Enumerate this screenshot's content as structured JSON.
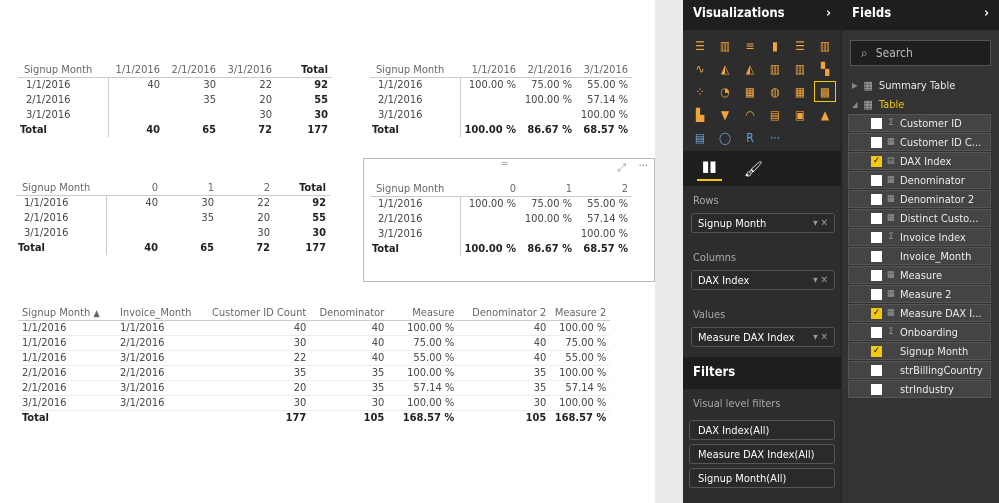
{
  "matrix1": {
    "headers": [
      "Signup Month",
      "1/1/2016",
      "2/1/2016",
      "3/1/2016",
      "Total"
    ],
    "rows": [
      [
        "1/1/2016",
        "40",
        "30",
        "22",
        "92"
      ],
      [
        "2/1/2016",
        "",
        "35",
        "20",
        "55"
      ],
      [
        "3/1/2016",
        "",
        "",
        "30",
        "30"
      ]
    ],
    "total": [
      "Total",
      "40",
      "65",
      "72",
      "177"
    ]
  },
  "matrix2": {
    "headers": [
      "Signup Month",
      "1/1/2016",
      "2/1/2016",
      "3/1/2016"
    ],
    "rows": [
      [
        "1/1/2016",
        "100.00 %",
        "75.00 %",
        "55.00 %"
      ],
      [
        "2/1/2016",
        "",
        "100.00 %",
        "57.14 %"
      ],
      [
        "3/1/2016",
        "",
        "",
        "100.00 %"
      ]
    ],
    "total": [
      "Total",
      "100.00 %",
      "86.67 %",
      "68.57 %"
    ]
  },
  "matrix3": {
    "headers": [
      "Signup Month",
      "0",
      "1",
      "2",
      "Total"
    ],
    "rows": [
      [
        "1/1/2016",
        "40",
        "30",
        "22",
        "92"
      ],
      [
        "2/1/2016",
        "",
        "35",
        "20",
        "55"
      ],
      [
        "3/1/2016",
        "",
        "",
        "30",
        "30"
      ]
    ],
    "total": [
      "Total",
      "40",
      "65",
      "72",
      "177"
    ]
  },
  "matrix4": {
    "headers": [
      "Signup Month",
      "0",
      "1",
      "2"
    ],
    "rows": [
      [
        "1/1/2016",
        "100.00 %",
        "75.00 %",
        "55.00 %"
      ],
      [
        "2/1/2016",
        "",
        "100.00 %",
        "57.14 %"
      ],
      [
        "3/1/2016",
        "",
        "",
        "100.00 %"
      ]
    ],
    "total": [
      "Total",
      "100.00 %",
      "86.67 %",
      "68.57 %"
    ]
  },
  "table5": {
    "headers": [
      "Signup Month",
      "Invoice_Month",
      "Customer ID Count",
      "Denominator",
      "Measure",
      "Denominator 2",
      "Measure 2"
    ],
    "sort_indicator": "▲",
    "rows": [
      [
        "1/1/2016",
        "1/1/2016",
        "40",
        "40",
        "100.00 %",
        "40",
        "100.00 %"
      ],
      [
        "1/1/2016",
        "2/1/2016",
        "30",
        "40",
        "75.00 %",
        "40",
        "75.00 %"
      ],
      [
        "1/1/2016",
        "3/1/2016",
        "22",
        "40",
        "55.00 %",
        "40",
        "55.00 %"
      ],
      [
        "2/1/2016",
        "2/1/2016",
        "35",
        "35",
        "100.00 %",
        "35",
        "100.00 %"
      ],
      [
        "2/1/2016",
        "3/1/2016",
        "20",
        "35",
        "57.14 %",
        "35",
        "57.14 %"
      ],
      [
        "3/1/2016",
        "3/1/2016",
        "30",
        "30",
        "100.00 %",
        "30",
        "100.00 %"
      ]
    ],
    "total": [
      "Total",
      "",
      "177",
      "105",
      "168.57 %",
      "105",
      "168.57 %"
    ]
  },
  "visual_header": {
    "more": "···"
  },
  "visualizations": {
    "title": "Visualizations",
    "more_icons": "···",
    "rows_label": "Rows",
    "rows_value": "Signup Month",
    "columns_label": "Columns",
    "columns_value": "DAX Index",
    "values_label": "Values",
    "values_value": "Measure DAX Index",
    "filters_title": "Filters",
    "visual_level_filters": "Visual level filters",
    "filters": [
      "DAX Index(All)",
      "Measure DAX Index(All)",
      "Signup Month(All)"
    ]
  },
  "fields": {
    "title": "Fields",
    "search_placeholder": "Search",
    "tables": [
      "Summary Table",
      "Table"
    ],
    "items": [
      {
        "label": "Customer ID",
        "type": "Σ",
        "checked": false
      },
      {
        "label": "Customer ID C...",
        "type": "▦",
        "checked": false
      },
      {
        "label": "DAX Index",
        "type": "▤",
        "checked": true
      },
      {
        "label": "Denominator",
        "type": "▦",
        "checked": false
      },
      {
        "label": "Denominator 2",
        "type": "▦",
        "checked": false
      },
      {
        "label": "Distinct Custo...",
        "type": "▦",
        "checked": false
      },
      {
        "label": "Invoice Index",
        "type": "Σ",
        "checked": false
      },
      {
        "label": "Invoice_Month",
        "type": "",
        "checked": false
      },
      {
        "label": "Measure",
        "type": "▦",
        "checked": false
      },
      {
        "label": "Measure 2",
        "type": "▦",
        "checked": false
      },
      {
        "label": "Measure DAX I...",
        "type": "▦",
        "checked": true
      },
      {
        "label": "Onboarding",
        "type": "Σ",
        "checked": false
      },
      {
        "label": "Signup Month",
        "type": "",
        "checked": true
      },
      {
        "label": "strBillingCountry",
        "type": "",
        "checked": false
      },
      {
        "label": "strIndustry",
        "type": "",
        "checked": false
      }
    ]
  },
  "accent": "#f2c811"
}
